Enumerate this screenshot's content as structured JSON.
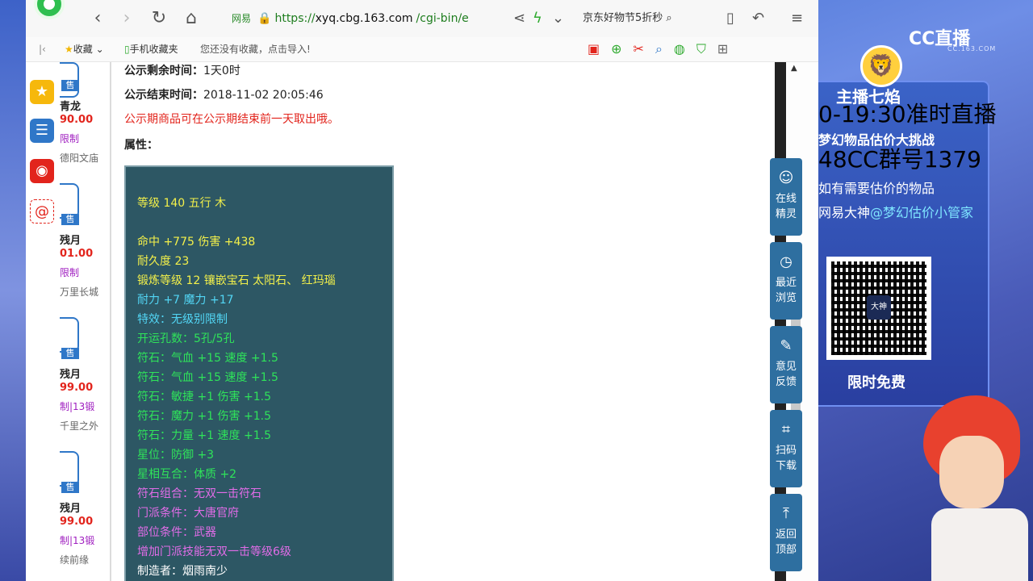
{
  "browser": {
    "address": {
      "site_label": "网易",
      "url_prefix": "https://",
      "url_host": "xyq.cbg.163.com",
      "url_path": "/cgi-bin/e"
    },
    "search_text": "京东好物节5折秒",
    "bookmarks": {
      "collect_label": "收藏",
      "mobile_label": "手机收藏夹",
      "import_hint": "您还没有收藏，点击导入!"
    }
  },
  "sidebar_list": [
    {
      "badge": "售",
      "name": "青龙",
      "price": "90.00",
      "tag": "限制",
      "server": "德阳文庙"
    },
    {
      "badge": "售",
      "name": "残月",
      "price": "01.00",
      "tag": "限制",
      "server": "万里长城"
    },
    {
      "badge": "售",
      "name": "残月",
      "price": "99.00",
      "tag": "制|13锻",
      "server": "千里之外"
    },
    {
      "badge": "售",
      "name": "残月",
      "price": "99.00",
      "tag": "制|13锻",
      "server": "续前缘"
    }
  ],
  "detail": {
    "remaining_label": "公示剩余时间：",
    "remaining_value": "1天0时",
    "end_label": "公示结束时间：",
    "end_value": "2018-11-02 20:05:46",
    "notice": "公示期商品可在公示期结束前一天取出哦。",
    "attr_label": "属性：",
    "attributes": [
      {
        "text": "等级 140 五行 木",
        "color": "y"
      },
      {
        "text": "命中 +775 伤害 +438",
        "color": "y"
      },
      {
        "text": "耐久度 23",
        "color": "y"
      },
      {
        "text": "锻炼等级 12 镶嵌宝石 太阳石、 红玛瑙",
        "color": "y"
      },
      {
        "text": "耐力 +7 魔力 +17",
        "color": "c"
      },
      {
        "text": "特效：无级别限制",
        "color": "c"
      },
      {
        "text": "开运孔数：5孔/5孔",
        "color": "g"
      },
      {
        "text": "符石：气血 +15 速度 +1.5",
        "color": "g"
      },
      {
        "text": "符石：气血 +15 速度 +1.5",
        "color": "g"
      },
      {
        "text": "符石：敏捷 +1 伤害 +1.5",
        "color": "g"
      },
      {
        "text": "符石：魔力 +1 伤害 +1.5",
        "color": "g"
      },
      {
        "text": "符石：力量 +1 速度 +1.5",
        "color": "g"
      },
      {
        "text": "星位：防御 +3",
        "color": "g"
      },
      {
        "text": "星相互合：体质 +2",
        "color": "g"
      },
      {
        "text": "符石组合：无双一击符石",
        "color": "p"
      },
      {
        "text": "门派条件：大唐官府",
        "color": "p"
      },
      {
        "text": "部位条件：武器",
        "color": "p"
      },
      {
        "text": "增加门派技能无双一击等级6级",
        "color": "p"
      },
      {
        "text": "制造者：烟雨南少",
        "color": "w"
      }
    ]
  },
  "float_panel": [
    {
      "label1": "在线",
      "label2": "精灵"
    },
    {
      "label1": "最近",
      "label2": "浏览"
    },
    {
      "label1": "意见",
      "label2": "反馈"
    },
    {
      "label1": "扫码",
      "label2": "下载"
    },
    {
      "label1": "返回",
      "label2": "顶部"
    }
  ],
  "stream": {
    "cc_logo": "CC直播",
    "cc_sub": "CC.163.COM",
    "host": "主播七焰",
    "overlay_line1": "0-19:30准时直播",
    "overlay_line2": "48CC群号1379",
    "title": "梦幻物品估价大挑战",
    "desc1": "如有需要估价的物品",
    "desc2_prefix": "网易大神",
    "desc2_highlight": "@梦幻估价小管家",
    "qr_center": "大神",
    "free": "限时免费"
  }
}
